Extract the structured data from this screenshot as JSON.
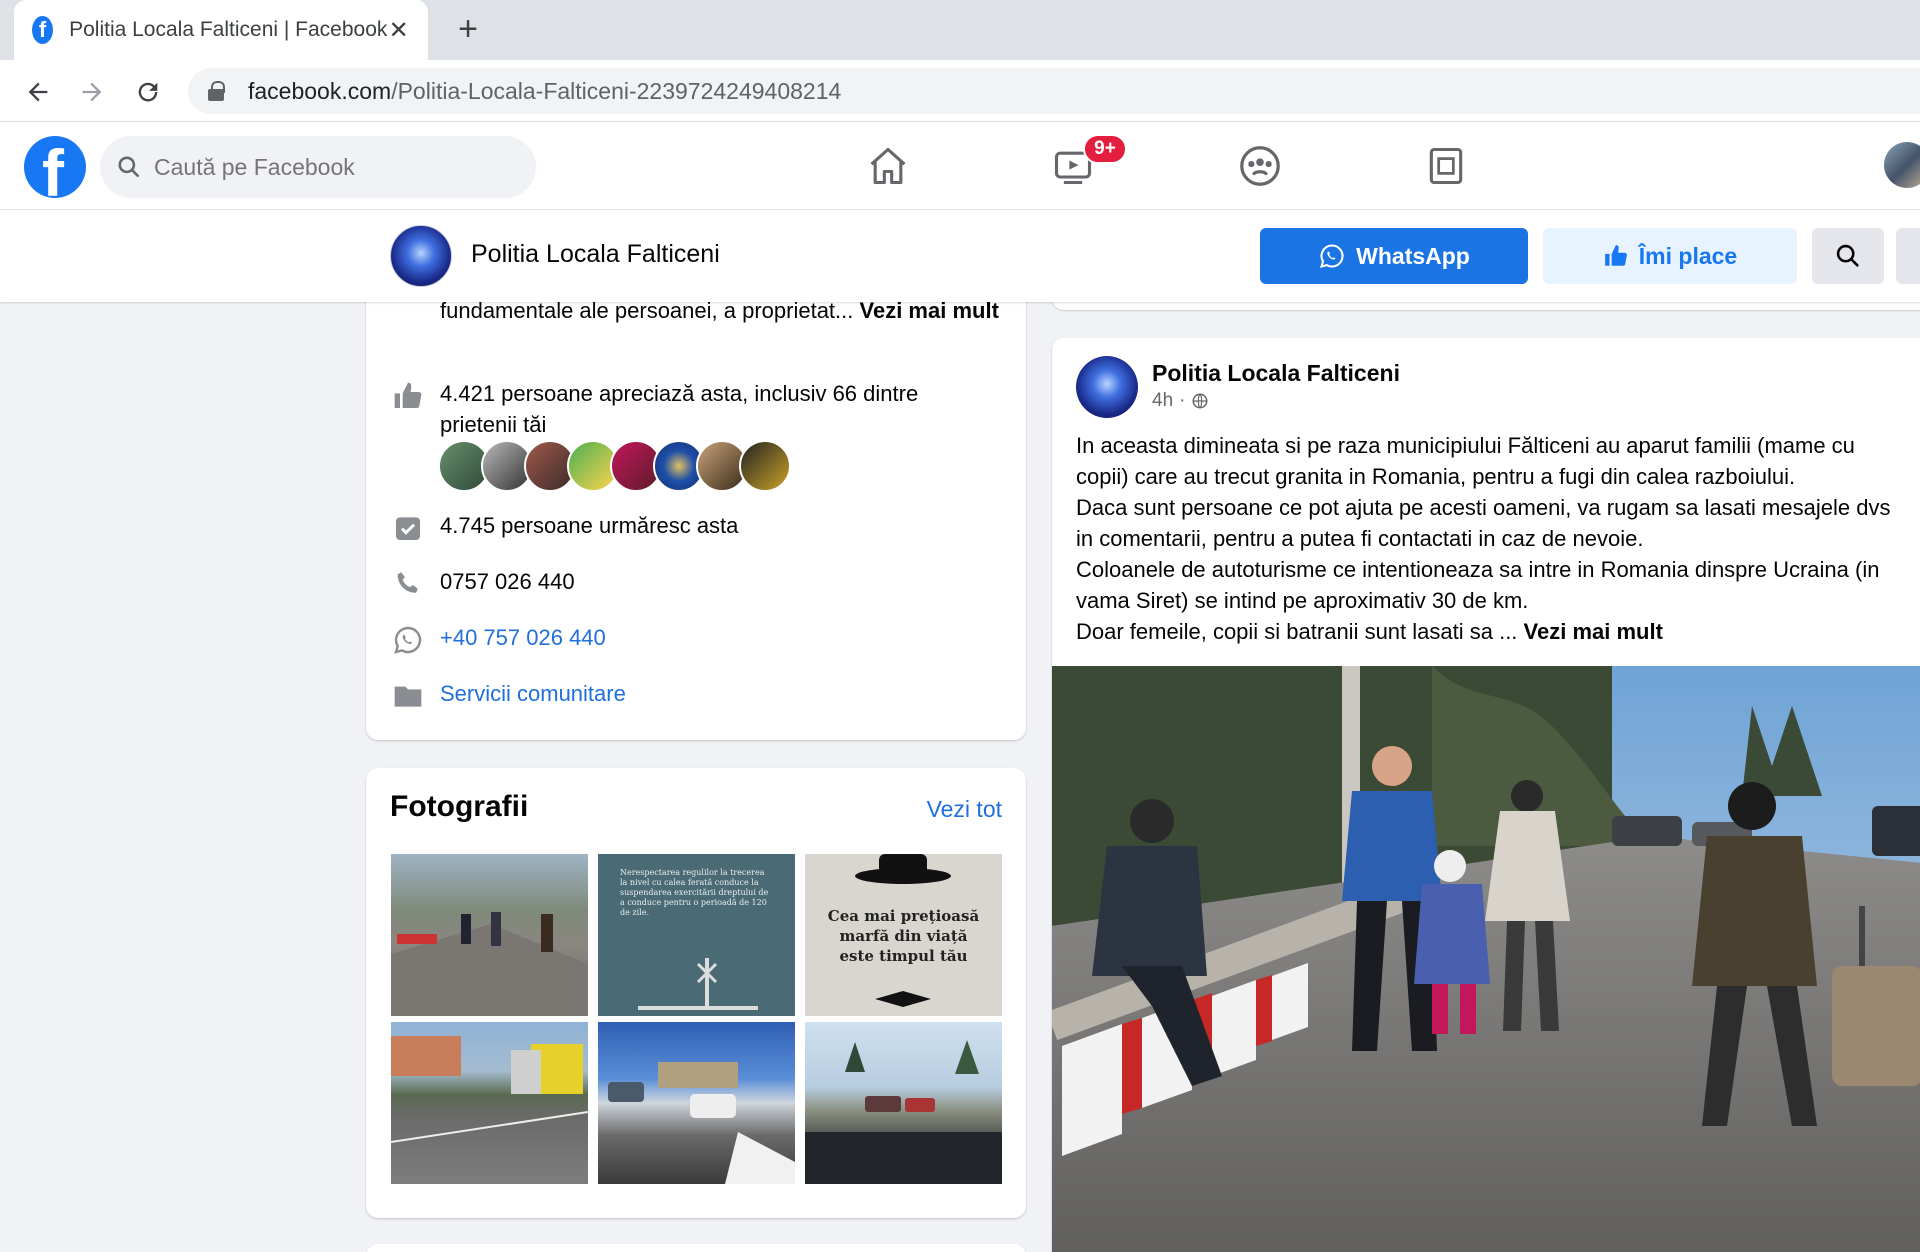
{
  "browser": {
    "tab_title": "Politia Locala Falticeni | Facebook",
    "tab_close": "✕",
    "new_tab": "+",
    "url_host": "facebook.com",
    "url_path": "/Politia-Locala-Falticeni-2239724249408214"
  },
  "fbnav": {
    "search_placeholder": "Caută pe Facebook",
    "video_badge": "9+"
  },
  "page_header": {
    "name": "Politia Locala Falticeni",
    "whatsapp_label": "WhatsApp",
    "like_label": "Îmi place"
  },
  "intro": {
    "text": "fundamentale ale persoanei, a proprietat...",
    "see_more": "Vezi mai mult",
    "likes": "4.421 persoane apreciază asta, inclusiv 66 dintre prietenii tăi",
    "followers": "4.745 persoane urmăresc asta",
    "phone": "0757 026 440",
    "whatsapp": "+40 757 026 440",
    "category": "Servicii comunitare"
  },
  "photos": {
    "title": "Fotografii",
    "see_all": "Vezi tot",
    "thumb2_text": "Nerespectarea regulilor la trecerea la nivel cu calea ferată conduce la suspendarea exercitării dreptului de a conduce pentru o perioadă de 120 de zile.",
    "thumb3_text": "Cea mai prețioasă marfă din viață este timpul tău"
  },
  "post": {
    "author": "Politia Locala Falticeni",
    "time": "4h",
    "dots": "···",
    "lines": [
      "In aceasta dimineata si pe raza municipiului Fălticeni au aparut familii (mame cu",
      "copii) care au trecut granita in Romania, pentru a fugi din calea razboiului.",
      "Daca sunt persoane ce pot ajuta pe acesti oameni, va rugam sa lasati mesajele dvs",
      "in comentarii, pentru a putea fi contactati in caz de nevoie.",
      "Coloanele de autoturisme ce intentioneaza sa intre in Romania dinspre Ucraina (in",
      "vama Siret) se intind pe aproximativ 30 de km."
    ],
    "last_line": "Doar femeile, copii si batranii sunt lasati sa ...",
    "see_more": "Vezi mai mult"
  },
  "colors": {
    "fb_blue": "#1877f2",
    "link_blue": "#216fdb",
    "badge_red": "#e41e3f",
    "page_bg": "#f0f2f5"
  },
  "icons": [
    "facebook-favicon",
    "back-arrow-icon",
    "forward-arrow-icon",
    "reload-icon",
    "lock-icon",
    "search-icon",
    "home-icon",
    "watch-icon",
    "groups-icon",
    "gaming-icon",
    "whatsapp-icon",
    "thumbs-up-icon",
    "check-box-icon",
    "phone-icon",
    "folder-icon",
    "globe-icon"
  ]
}
